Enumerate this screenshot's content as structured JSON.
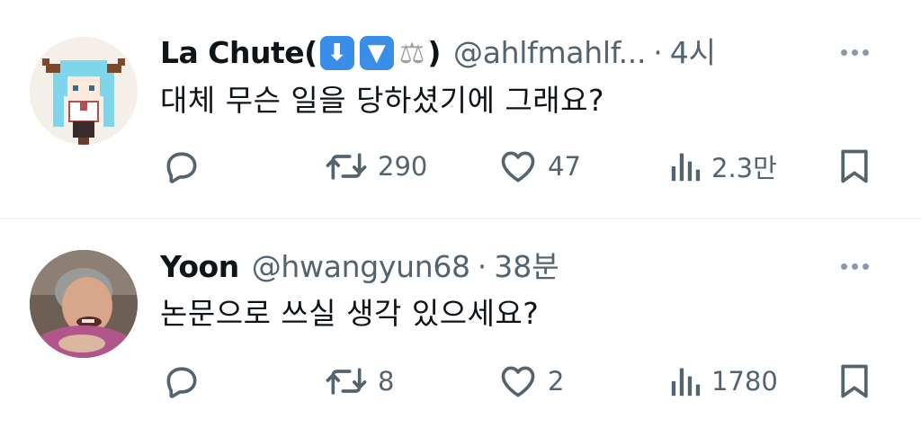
{
  "colors": {
    "text": "#0f1419",
    "secondary": "#536471",
    "divider": "#eff3f4",
    "icon": "#536471"
  },
  "tweets": [
    {
      "display_name": "La Chute(",
      "display_name_end": ")",
      "emoji_1": "⬇",
      "emoji_2": "▼",
      "emoji_3": "⚖",
      "handle": "@ahlfmahlf...",
      "separator": "·",
      "time": "4시",
      "text": "대체 무슨 일을 당하셨기에 그래요?",
      "retweets": "290",
      "likes": "47",
      "views": "2.3만",
      "avatar_icon": "pixel-anime-girl-avatar"
    },
    {
      "display_name": "Yoon",
      "handle": "@hwangyun68",
      "separator": "·",
      "time": "38분",
      "text": "논문으로 쓰실 생각 있으세요?",
      "retweets": "8",
      "likes": "2",
      "views": "1780",
      "avatar_icon": "smiling-person-photo-avatar"
    }
  ]
}
